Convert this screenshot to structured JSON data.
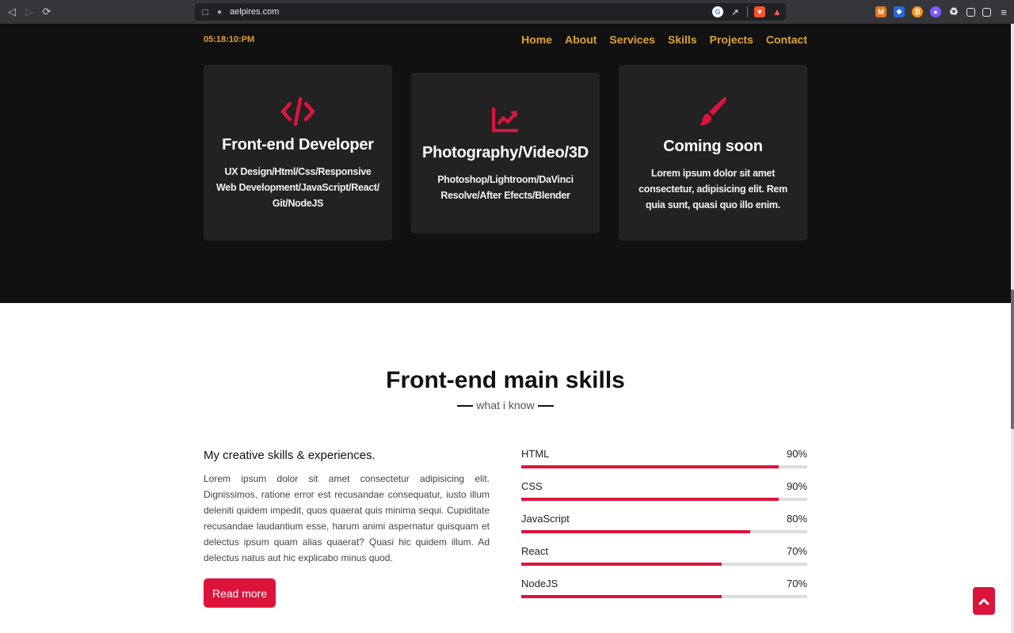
{
  "browser": {
    "url": "aelpires.com",
    "back_icon": "back-icon",
    "forward_icon": "forward-icon",
    "reload_icon": "reload-icon"
  },
  "header": {
    "clock": "05:18:10:PM",
    "nav": [
      "Home",
      "About",
      "Services",
      "Skills",
      "Projects",
      "Contact"
    ]
  },
  "services": [
    {
      "icon": "code-icon",
      "title": "Front-end Developer",
      "text": "UX Design/Html/Css/Responsive Web Development/JavaScript/React/ Git/NodeJS"
    },
    {
      "icon": "chart-line-icon",
      "title": "Photography/Video/3D",
      "text": "Photoshop/Lightroom/DaVinci Resolve/After Efects/Blender"
    },
    {
      "icon": "paint-brush-icon",
      "title": "Coming soon",
      "text": "Lorem ipsum dolor sit amet consectetur, adipisicing elit. Rem quia sunt, quasi quo illo enim."
    }
  ],
  "skills": {
    "title": "Front-end main skills",
    "subtitle": "what i know",
    "heading": "My creative skills & experiences.",
    "paragraph": "Lorem ipsum dolor sit amet consectetur adipisicing elit. Dignissimos, ratione error est recusandae consequatur, iusto illum deleniti quidem impedit, quos quaerat quis minima sequi. Cupiditate recusandae laudantium esse, harum animi aspernatur quisquam et delectus ipsum quam alias quaerat? Quasi hic quidem illum. Ad delectus natus aut hic explicabo minus quod.",
    "read_more": "Read more",
    "bars": [
      {
        "name": "HTML",
        "percent": "90%",
        "value": 90
      },
      {
        "name": "CSS",
        "percent": "90%",
        "value": 90
      },
      {
        "name": "JavaScript",
        "percent": "80%",
        "value": 80
      },
      {
        "name": "React",
        "percent": "70%",
        "value": 70
      },
      {
        "name": "NodeJS",
        "percent": "70%",
        "value": 70
      }
    ]
  },
  "colors": {
    "accent": "#dc143c",
    "nav": "#e0a12f",
    "dark_bg": "#111111",
    "card_bg": "#222222"
  }
}
